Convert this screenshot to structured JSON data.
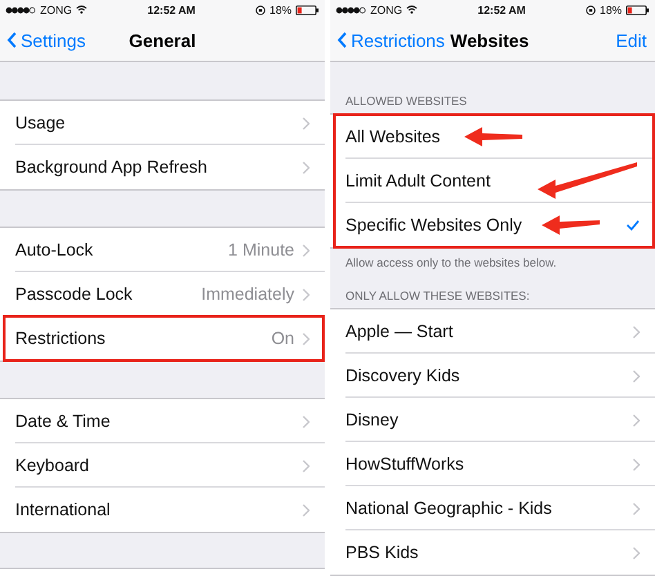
{
  "screens": [
    {
      "status_bar": {
        "carrier": "ZONG",
        "time": "12:52 AM",
        "battery": "18%"
      },
      "nav": {
        "back": "Settings",
        "title": "General"
      },
      "groups": [
        {
          "rows": [
            {
              "label": "Usage",
              "kind": "link"
            },
            {
              "label": "Background App Refresh",
              "kind": "link"
            }
          ]
        },
        {
          "rows": [
            {
              "label": "Auto-Lock",
              "value": "1 Minute",
              "kind": "link"
            },
            {
              "label": "Passcode Lock",
              "value": "Immediately",
              "kind": "link"
            },
            {
              "label": "Restrictions",
              "value": "On",
              "kind": "link",
              "highlighted": true
            }
          ]
        },
        {
          "rows": [
            {
              "label": "Date & Time",
              "kind": "link"
            },
            {
              "label": "Keyboard",
              "kind": "link"
            },
            {
              "label": "International",
              "kind": "link"
            }
          ]
        }
      ]
    },
    {
      "status_bar": {
        "carrier": "ZONG",
        "time": "12:52 AM",
        "battery": "18%"
      },
      "nav": {
        "back": "Restrictions",
        "title": "Websites",
        "action": "Edit"
      },
      "groups": [
        {
          "header": "ALLOWED WEBSITES",
          "highlighted": true,
          "footer": "Allow access only to the websites below.",
          "rows": [
            {
              "label": "All Websites",
              "kind": "option",
              "selected": false,
              "arrow": true
            },
            {
              "label": "Limit Adult Content",
              "kind": "option",
              "selected": false,
              "arrow": true
            },
            {
              "label": "Specific Websites Only",
              "kind": "option",
              "selected": true,
              "arrow": true
            }
          ]
        },
        {
          "header": "ONLY ALLOW THESE WEBSITES:",
          "rows": [
            {
              "label": "Apple — Start",
              "kind": "link"
            },
            {
              "label": "Discovery Kids",
              "kind": "link"
            },
            {
              "label": "Disney",
              "kind": "link"
            },
            {
              "label": "HowStuffWorks",
              "kind": "link"
            },
            {
              "label": "National Geographic - Kids",
              "kind": "link"
            },
            {
              "label": "PBS Kids",
              "kind": "link"
            }
          ]
        }
      ]
    }
  ]
}
